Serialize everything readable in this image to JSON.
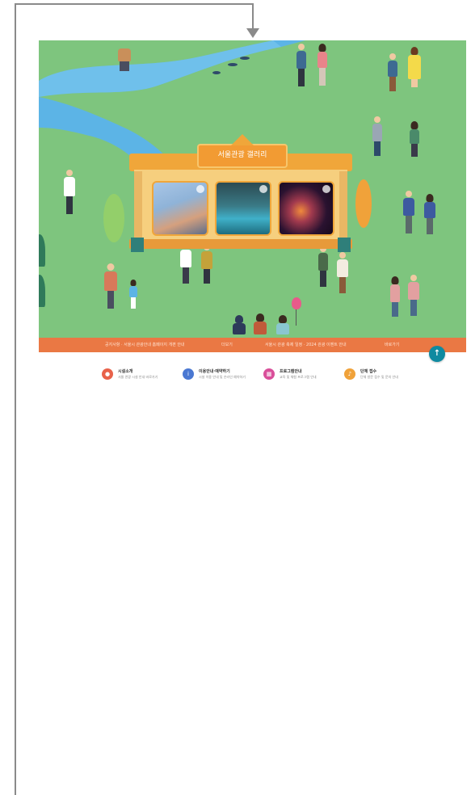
{
  "hero": {
    "building_sign": "서울관광 갤러리",
    "photos": [
      {
        "name": "photo-crowd"
      },
      {
        "name": "photo-pond-boat"
      },
      {
        "name": "photo-night-lanterns"
      }
    ]
  },
  "notice_bar": {
    "items": [
      "공지사항 · 서울시 관광안내 홈페이지 개편 안내",
      "더보기",
      "서울시 관광 축제 일정 · 2024 관광 이벤트 안내",
      "바로가기"
    ]
  },
  "top_button": {
    "label": "↑"
  },
  "quick_menu": {
    "items": [
      {
        "icon": "location-pin-icon",
        "title": "시설소개",
        "desc": "서울 관광 시설 안내 바로가기",
        "color": "#e8624a"
      },
      {
        "icon": "info-icon",
        "title": "이용안내·예약하기",
        "desc": "시설 이용 안내 및 온라인 예약하기",
        "color": "#4a78d2"
      },
      {
        "icon": "calendar-icon",
        "title": "프로그램안내",
        "desc": "교육 및 체험 프로그램 안내",
        "color": "#d94f9a"
      },
      {
        "icon": "bell-icon",
        "title": "단체 접수",
        "desc": "단체 방문 접수 및 문의 안내",
        "color": "#f0a23a"
      }
    ]
  },
  "colors": {
    "grass": "#7ec57e",
    "river": "#5cb4e6",
    "notice_bar": "#ea7844",
    "accent_teal": "#0f8aa0"
  }
}
